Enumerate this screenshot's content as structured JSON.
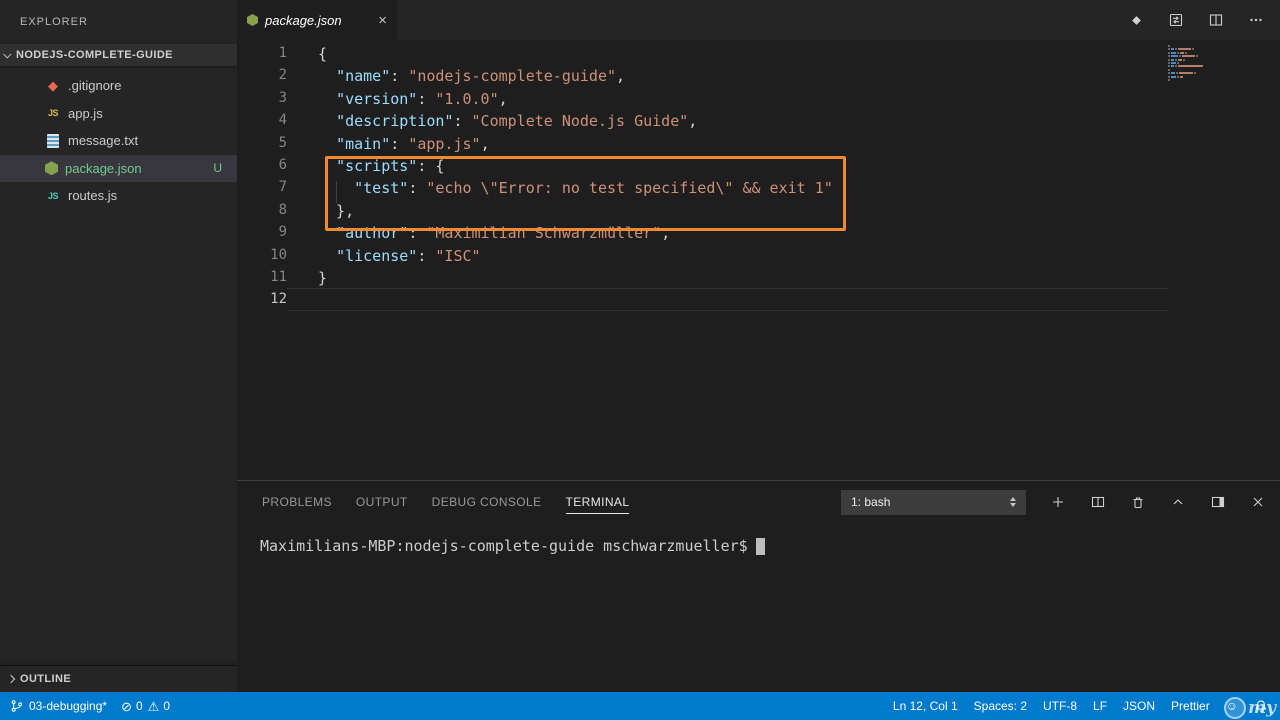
{
  "sidebar": {
    "title": "EXPLORER",
    "folder": {
      "name": "NODEJS-COMPLETE-GUIDE"
    },
    "files": [
      {
        "name": ".gitignore",
        "icon": "git-icon"
      },
      {
        "name": "app.js",
        "icon": "js-icon"
      },
      {
        "name": "message.txt",
        "icon": "text-icon"
      },
      {
        "name": "package.json",
        "icon": "npm-icon",
        "badge": "U",
        "selected": true
      },
      {
        "name": "routes.js",
        "icon": "js-teal-icon"
      }
    ],
    "outline": "OUTLINE"
  },
  "editor": {
    "tab": {
      "label": "package.json",
      "close": "×"
    },
    "current_line": 12,
    "annotation": {
      "lines": "6-8",
      "border_color": "#ee8936"
    },
    "colors": {
      "key": "#9cdcfe",
      "string": "#ce9178",
      "punctuation": "#d4d4d4",
      "line_number": "#858585"
    },
    "lines": [
      [
        [
          "p",
          "{"
        ]
      ],
      [
        [
          "p",
          "  "
        ],
        [
          "k",
          "\"name\""
        ],
        [
          "p",
          ": "
        ],
        [
          "s",
          "\"nodejs-complete-guide\""
        ],
        [
          "p",
          ","
        ]
      ],
      [
        [
          "p",
          "  "
        ],
        [
          "k",
          "\"version\""
        ],
        [
          "p",
          ": "
        ],
        [
          "s",
          "\"1.0.0\""
        ],
        [
          "p",
          ","
        ]
      ],
      [
        [
          "p",
          "  "
        ],
        [
          "k",
          "\"description\""
        ],
        [
          "p",
          ": "
        ],
        [
          "s",
          "\"Complete Node.js Guide\""
        ],
        [
          "p",
          ","
        ]
      ],
      [
        [
          "p",
          "  "
        ],
        [
          "k",
          "\"main\""
        ],
        [
          "p",
          ": "
        ],
        [
          "s",
          "\"app.js\""
        ],
        [
          "p",
          ","
        ]
      ],
      [
        [
          "p",
          "  "
        ],
        [
          "k",
          "\"scripts\""
        ],
        [
          "p",
          ": {"
        ]
      ],
      [
        [
          "p",
          "    "
        ],
        [
          "k",
          "\"test\""
        ],
        [
          "p",
          ": "
        ],
        [
          "s",
          "\"echo \\\"Error: no test specified\\\" && exit 1\""
        ]
      ],
      [
        [
          "p",
          "  },"
        ]
      ],
      [
        [
          "p",
          "  "
        ],
        [
          "k",
          "\"author\""
        ],
        [
          "p",
          ": "
        ],
        [
          "s",
          "\"Maximilian Schwarzmüller\""
        ],
        [
          "p",
          ","
        ]
      ],
      [
        [
          "p",
          "  "
        ],
        [
          "k",
          "\"license\""
        ],
        [
          "p",
          ": "
        ],
        [
          "s",
          "\"ISC\""
        ]
      ],
      [
        [
          "p",
          "}"
        ]
      ],
      []
    ]
  },
  "panel": {
    "tabs": [
      {
        "label": "PROBLEMS"
      },
      {
        "label": "OUTPUT"
      },
      {
        "label": "DEBUG CONSOLE"
      },
      {
        "label": "TERMINAL",
        "active": true
      }
    ],
    "shell_selector": "1: bash",
    "prompt": "Maximilians-MBP:nodejs-complete-guide mschwarzmueller$"
  },
  "statusbar": {
    "branch": "03-debugging*",
    "errors": "0",
    "warnings": "0",
    "position": "Ln 12, Col 1",
    "indentation": "Spaces: 2",
    "encoding": "UTF-8",
    "eol": "LF",
    "language": "JSON",
    "formatter": "Prettier",
    "watermark": "my",
    "background": "#007acc"
  }
}
